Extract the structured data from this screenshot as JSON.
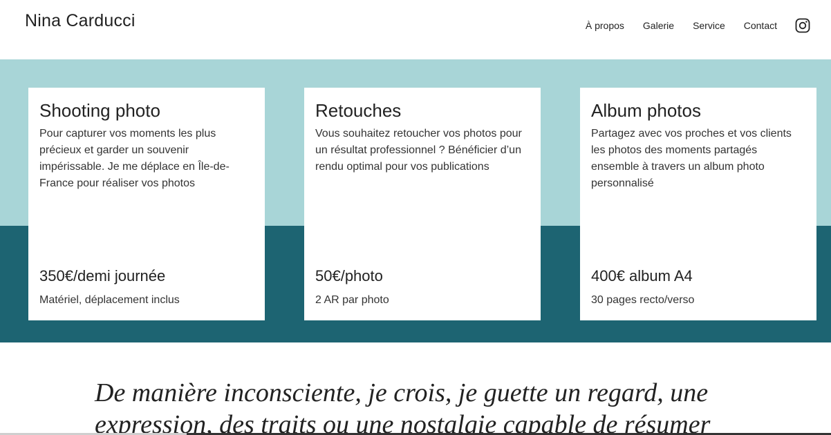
{
  "header": {
    "brand": "Nina Carducci",
    "nav": [
      "À propos",
      "Galerie",
      "Service",
      "Contact"
    ],
    "social_icon": "instagram-icon"
  },
  "services": [
    {
      "title": "Shooting photo",
      "description": "Pour capturer vos moments les plus précieux et garder un souvenir impérissable. Je me déplace en Île-de-France pour réaliser vos photos",
      "price": "350€/demi journée",
      "note": "Matériel, déplacement inclus"
    },
    {
      "title": "Retouches",
      "description": "Vous souhaitez retoucher vos photos pour un résultat professionnel ? Bénéficier d’un rendu optimal pour vos publications",
      "price": "50€/photo",
      "note": "2 AR par photo"
    },
    {
      "title": "Album photos",
      "description": "Partagez avec vos proches et vos clients les photos des moments partagés ensemble à travers un album photo personnalisé",
      "price": "400€ album A4",
      "note": "30 pages recto/verso"
    }
  ],
  "quote": {
    "text": "De manière inconsciente, je crois, je guette un regard, une expression, des traits ou une nostalgie capable de résumer"
  },
  "colors": {
    "band_light": "#a8d5d7",
    "band_dark": "#1d6472",
    "card_bg": "#ffffff",
    "text": "#222222"
  }
}
